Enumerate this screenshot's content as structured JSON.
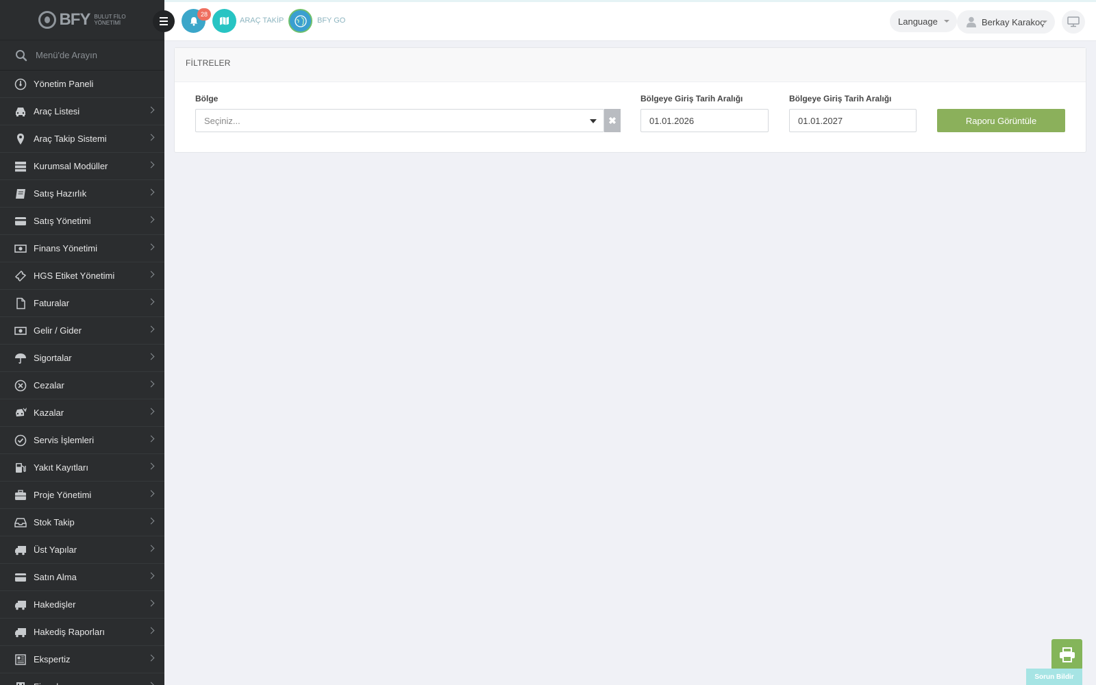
{
  "app": {
    "logo_text": "BFY",
    "logo_subtitle_1": "BULUT FİLO",
    "logo_subtitle_2": "YÖNETİMİ"
  },
  "sidebar": {
    "search_placeholder": "Menü'de Arayın",
    "items": [
      {
        "label": "Yönetim Paneli",
        "icon": "dashboard-icon",
        "has_submenu": false
      },
      {
        "label": "Araç Listesi",
        "icon": "car-icon",
        "has_submenu": true
      },
      {
        "label": "Araç Takip Sistemi",
        "icon": "map-pin-icon",
        "has_submenu": true
      },
      {
        "label": "Kurumsal Modüller",
        "icon": "server-icon",
        "has_submenu": true
      },
      {
        "label": "Satış Hazırlık",
        "icon": "book-icon",
        "has_submenu": true
      },
      {
        "label": "Satış Yönetimi",
        "icon": "credit-card-icon",
        "has_submenu": true
      },
      {
        "label": "Finans Yönetimi",
        "icon": "money-icon",
        "has_submenu": true
      },
      {
        "label": "HGS Etiket Yönetimi",
        "icon": "ticket-icon",
        "has_submenu": true
      },
      {
        "label": "Faturalar",
        "icon": "file-icon",
        "has_submenu": true
      },
      {
        "label": "Gelir / Gider",
        "icon": "money-icon",
        "has_submenu": true
      },
      {
        "label": "Sigortalar",
        "icon": "umbrella-icon",
        "has_submenu": true
      },
      {
        "label": "Cezalar",
        "icon": "times-circle-icon",
        "has_submenu": true
      },
      {
        "label": "Kazalar",
        "icon": "car-crash-icon",
        "has_submenu": true
      },
      {
        "label": "Servis İşlemleri",
        "icon": "check-circle-icon",
        "has_submenu": true
      },
      {
        "label": "Yakıt Kayıtları",
        "icon": "fuel-pump-icon",
        "has_submenu": true
      },
      {
        "label": "Proje Yönetimi",
        "icon": "briefcase-icon",
        "has_submenu": true
      },
      {
        "label": "Stok Takip",
        "icon": "inbox-icon",
        "has_submenu": true
      },
      {
        "label": "Üst Yapılar",
        "icon": "truck-icon",
        "has_submenu": true
      },
      {
        "label": "Satın Alma",
        "icon": "credit-card-icon",
        "has_submenu": true
      },
      {
        "label": "Hakedişler",
        "icon": "truck-icon",
        "has_submenu": true
      },
      {
        "label": "Hakediş Raporları",
        "icon": "truck-icon",
        "has_submenu": true
      },
      {
        "label": "Ekspertiz",
        "icon": "newspaper-icon",
        "has_submenu": true
      },
      {
        "label": "Firmalar",
        "icon": "building-icon",
        "has_submenu": true
      }
    ]
  },
  "topbar": {
    "notification_count": "28",
    "arac_takip_label": "ARAÇ TAKİP",
    "bfy_go_label": "BFY GO",
    "language_label": "Language",
    "user_name": "Berkay Karakoç"
  },
  "filters": {
    "panel_title": "FİLTRELER",
    "region_label": "Bölge",
    "region_placeholder": "Seçiniz...",
    "date_start_label": "Bölgeye Giriş Tarih Aralığı",
    "date_start_value": "01.01.2026",
    "date_end_label": "Bölgeye Giriş Tarih Aralığı",
    "date_end_value": "01.01.2027",
    "submit_label": "Raporu Görüntüle"
  },
  "floating": {
    "report_issue_label": "Sorun Bildir"
  },
  "colors": {
    "sidebar_bg": "#2b2d2f",
    "accent_green": "#8bb05b",
    "badge_red": "#ef6f5f",
    "bell_blue": "#3ba6c9",
    "map_teal": "#27c4c3"
  }
}
